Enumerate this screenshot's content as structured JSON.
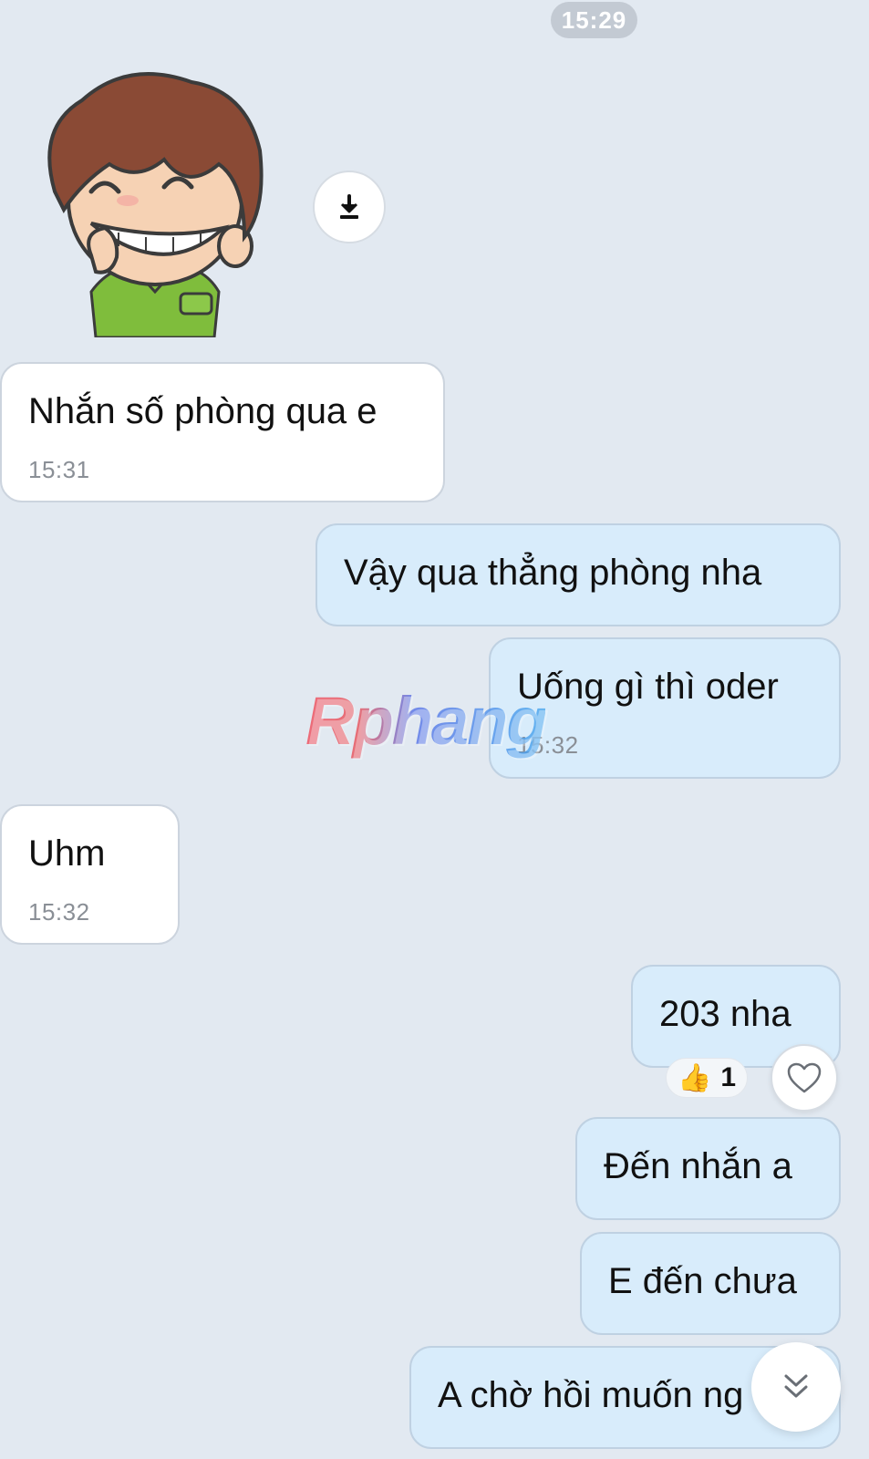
{
  "chat": {
    "date_separator_time": "15:29",
    "messages": [
      {
        "side": "in",
        "text": "Nhắn số phòng qua e",
        "time": "15:31"
      },
      {
        "side": "out",
        "text": "Vậy qua thẳng phòng nha"
      },
      {
        "side": "out",
        "text": "Uống gì thì oder",
        "time": "15:32"
      },
      {
        "side": "in",
        "text": "Uhm",
        "time": "15:32"
      },
      {
        "side": "out",
        "text": "203 nha",
        "reaction": {
          "emoji": "👍",
          "count": "1"
        }
      },
      {
        "side": "out",
        "text": "Đến nhắn a"
      },
      {
        "side": "out",
        "text": "E đến chưa"
      },
      {
        "side": "out",
        "text": "A chờ hồi muốn ng"
      }
    ]
  },
  "watermark": "Rphang",
  "icons": {
    "sticker": "cartoon-boy-laughing-sticker",
    "download": "download-icon",
    "heart": "heart-outline-icon",
    "scroll_down": "double-chevron-down-icon"
  },
  "colors": {
    "background": "#e2e9f1",
    "incoming_bubble": "#ffffff",
    "outgoing_bubble": "#d8ecfb",
    "timestamp": "#8a8f96"
  }
}
